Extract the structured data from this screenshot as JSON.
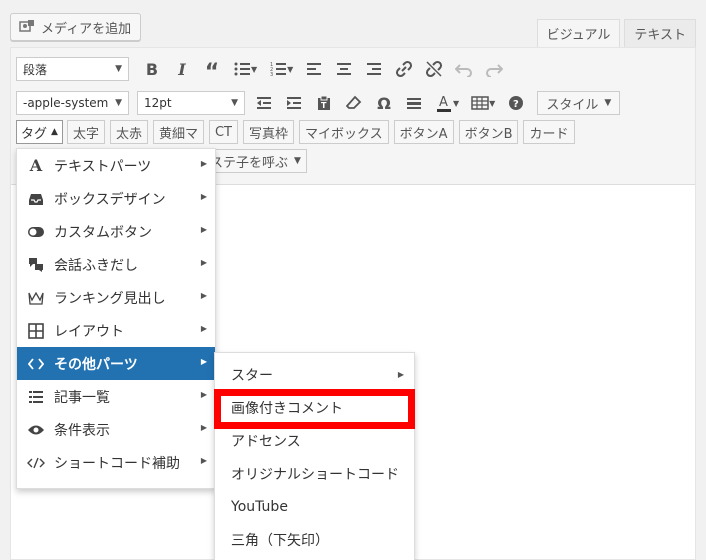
{
  "media_button": {
    "label": "メディアを追加",
    "icon": "media-icon"
  },
  "mode_tabs": [
    {
      "label": "ビジュアル",
      "active": true
    },
    {
      "label": "テキスト",
      "active": false
    }
  ],
  "toolbar": {
    "format_select": "段落",
    "font_family": "-apple-system",
    "font_size": "12pt",
    "style_button": "スタイル",
    "tag_button": "タグ",
    "quicktags": [
      "太字",
      "太赤",
      "黄細マ",
      "CT",
      "写真枠",
      "マイボックス",
      "ボタンA",
      "ボタンB",
      "カード"
    ],
    "template_button": "ステ子を呼ぶ"
  },
  "tag_menu": {
    "items": [
      {
        "label": "テキストパーツ",
        "icon": "letter-a-icon"
      },
      {
        "label": "ボックスデザイン",
        "icon": "inbox-icon"
      },
      {
        "label": "カスタムボタン",
        "icon": "toggle-icon"
      },
      {
        "label": "会話ふきだし",
        "icon": "speech-bubbles-icon"
      },
      {
        "label": "ランキング見出し",
        "icon": "crown-icon"
      },
      {
        "label": "レイアウト",
        "icon": "grid-icon"
      },
      {
        "label": "その他パーツ",
        "icon": "code-icon",
        "active": true
      },
      {
        "label": "記事一覧",
        "icon": "list-icon"
      },
      {
        "label": "条件表示",
        "icon": "eye-icon"
      },
      {
        "label": "ショートコード補助",
        "icon": "code-slash-icon"
      }
    ]
  },
  "submenu": {
    "items": [
      {
        "label": "スター",
        "has_sub": true
      },
      {
        "label": "画像付きコメント",
        "highlighted": true
      },
      {
        "label": "アドセンス"
      },
      {
        "label": "オリジナルショートコード"
      },
      {
        "label": "YouTube"
      },
      {
        "label": "三角（下矢印）"
      }
    ]
  },
  "colors": {
    "active_item_bg": "#2271b1",
    "highlight_border": "#ff0000"
  }
}
